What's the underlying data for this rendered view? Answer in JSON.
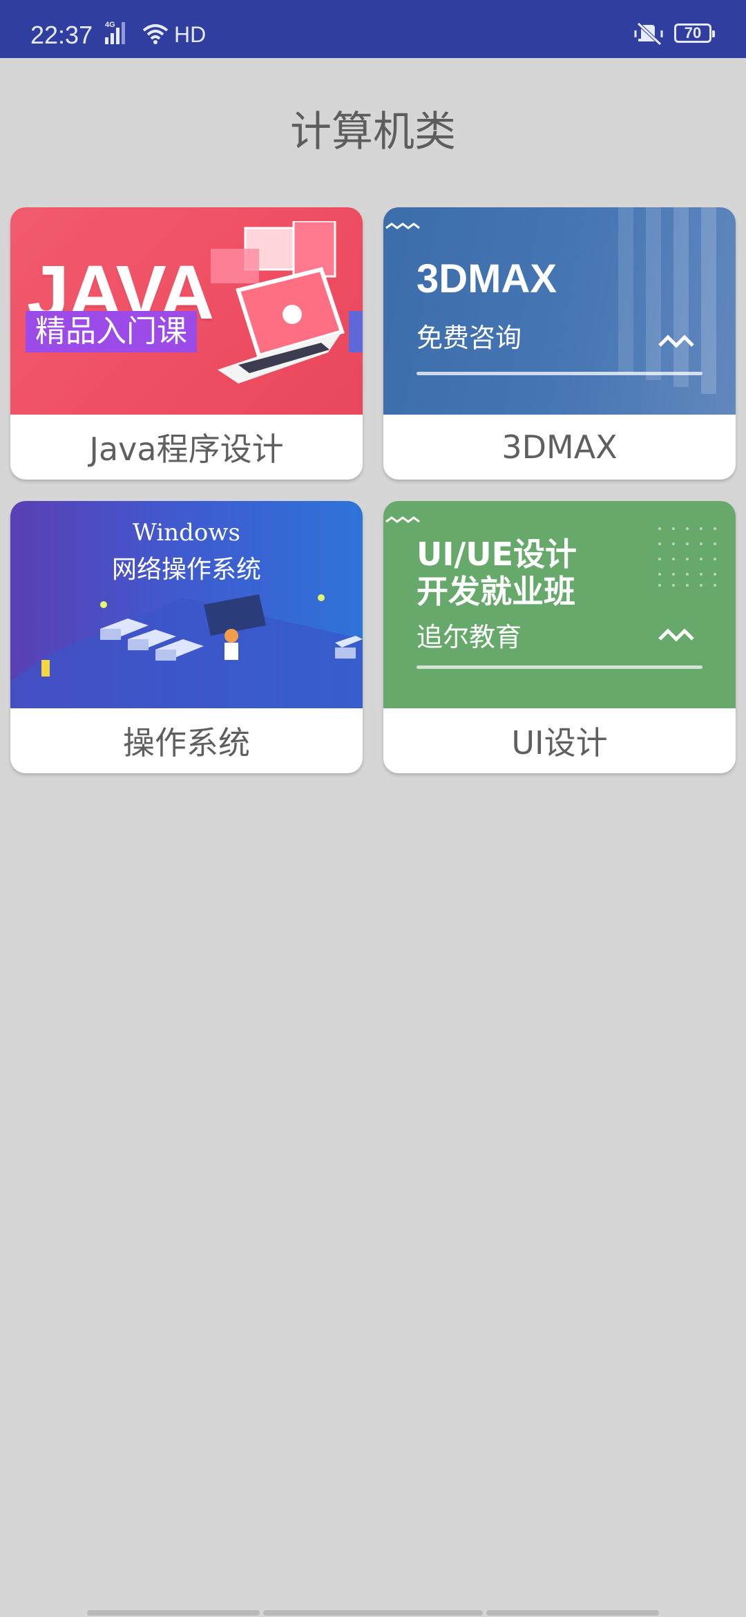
{
  "status_bar": {
    "time": "22:37",
    "network": "4G",
    "hd": "HD",
    "battery": "70"
  },
  "page": {
    "title": "计算机类"
  },
  "courses": [
    {
      "label": "Java程序设计",
      "banner": {
        "title": "JAVA",
        "tag": "精品入门课"
      },
      "color": "#f15a6d"
    },
    {
      "label": "3DMAX",
      "banner": {
        "title": "3DMAX",
        "subtitle": "免费咨询"
      },
      "color": "#4676b3"
    },
    {
      "label": "操作系统",
      "banner": {
        "title": "Windows",
        "subtitle": "网络操作系统"
      },
      "color": "#3f5bd0"
    },
    {
      "label": "UI设计",
      "banner": {
        "title_line1": "UI/UE设计",
        "title_line2": "开发就业班",
        "subtitle": "追尔教育"
      },
      "color": "#66a96a"
    }
  ]
}
